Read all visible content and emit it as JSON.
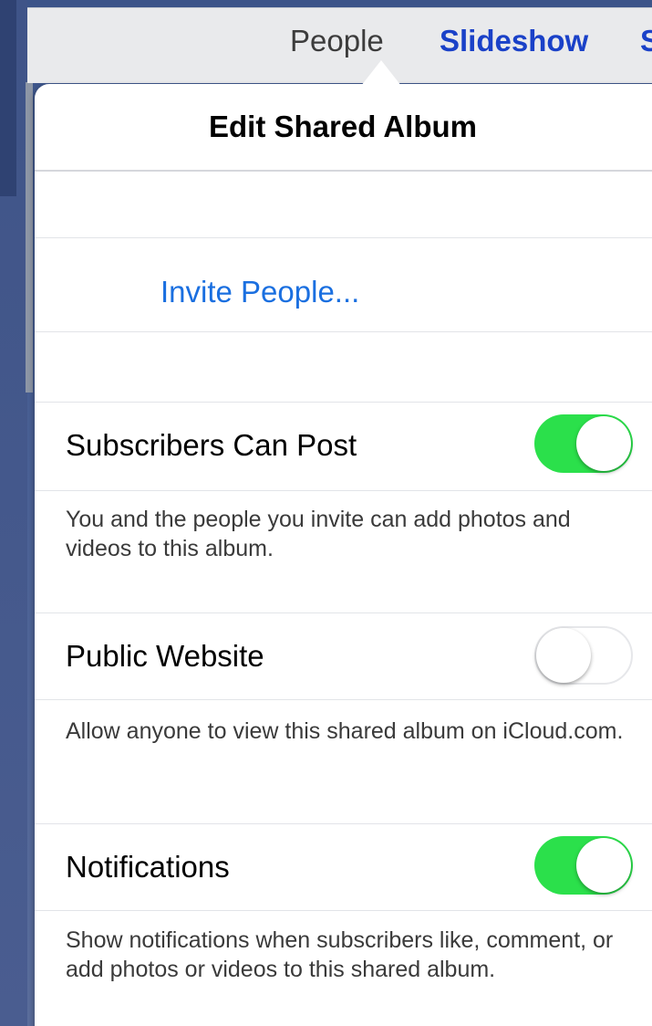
{
  "nav": {
    "people": "People",
    "slideshow": "Slideshow",
    "next_cut": "S"
  },
  "popover": {
    "title": "Edit Shared Album",
    "invite_label": "Invite People...",
    "settings": [
      {
        "label": "Subscribers Can Post",
        "enabled": true,
        "description": "You and the people you invite can add photos and videos to this album."
      },
      {
        "label": "Public Website",
        "enabled": false,
        "description": "Allow anyone to view this shared album on iCloud.com."
      },
      {
        "label": "Notifications",
        "enabled": true,
        "description": "Show notifications when subscribers like, comment, or add photos or videos to this shared album."
      }
    ]
  },
  "colors": {
    "accent": "#1a6fe0",
    "nav_link": "#1a41c8",
    "toggle_on": "#2be04b"
  }
}
